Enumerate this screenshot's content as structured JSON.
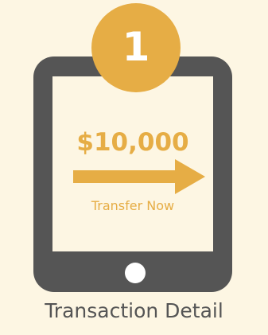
{
  "step": {
    "number": "1"
  },
  "device": {
    "amount": "$10,000",
    "action_label": "Transfer Now",
    "icon": "tablet-icon",
    "arrow_icon": "right-arrow-icon"
  },
  "caption": "Transaction Detail",
  "colors": {
    "background": "#fdf6e3",
    "accent": "#e6ad45",
    "device": "#555555",
    "screen": "#fdf6e3",
    "button": "#ffffff"
  }
}
